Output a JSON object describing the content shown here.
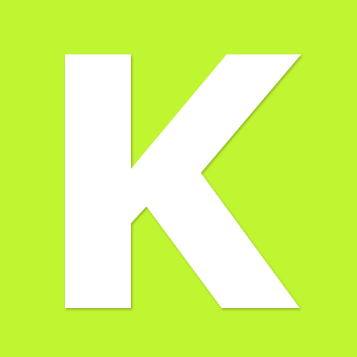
{
  "icon": {
    "name": "letter-k-icon",
    "letter": "K",
    "colors": {
      "background": "#c0f531",
      "letter": "#ffffff"
    }
  }
}
